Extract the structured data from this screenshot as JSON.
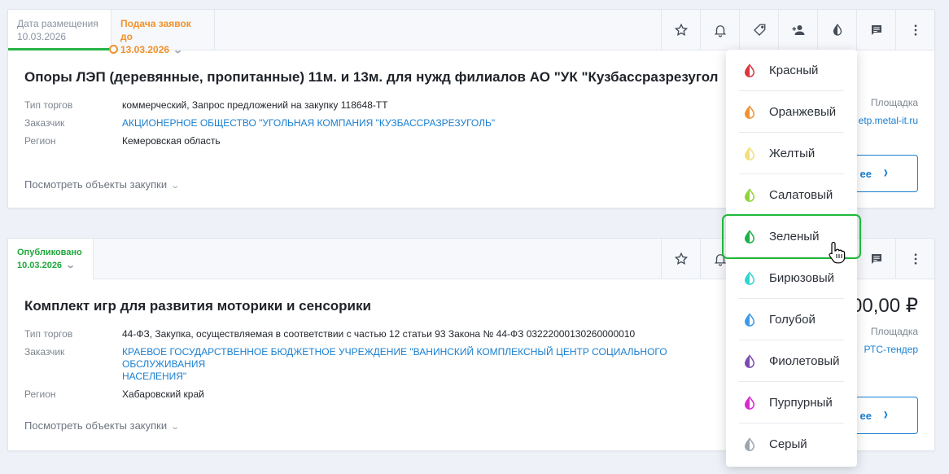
{
  "card1": {
    "posted_label": "Дата размещения",
    "posted_date": "10.03.2026",
    "deadline_label": "Подача заявок до",
    "deadline_date": "13.03.2026",
    "title": "Опоры ЛЭП (деревянные, пропитанные) 11м. и 13м. для нужд филиалов АО \"УК \"Кузбассразрезугол",
    "props": [
      {
        "key": "Тип торгов",
        "value": "коммерческий, Запрос предложений на закупку 118648-ТТ"
      },
      {
        "key": "Заказчик",
        "value": "АКЦИОНЕРНОЕ ОБЩЕСТВО \"УГОЛЬНАЯ КОМПАНИЯ \"КУЗБАССРАЗРЕЗУГОЛЬ\""
      },
      {
        "key": "Регион",
        "value": "Кемеровская область"
      }
    ],
    "platform_label": "Площадка",
    "platform_value": "etp.metal-it.ru",
    "more_label": "Посмотреть объекты закупки",
    "details_button": "ее"
  },
  "card2": {
    "status_label": "Опубликовано",
    "status_date": "10.03.2026",
    "title": "Комплект игр для развития моторики и сенсорики",
    "props": [
      {
        "key": "Тип торгов",
        "value": "44-ФЗ, Закупка, осуществляемая в соответствии с частью 12 статьи 93 Закона № 44-ФЗ 03222000130260000010"
      },
      {
        "key": "Заказчик",
        "value": "КРАЕВОЕ ГОСУДАРСТВЕННОЕ БЮДЖЕТНОЕ УЧРЕЖДЕНИЕ \"ВАНИНСКИЙ КОМПЛЕКСНЫЙ ЦЕНТР СОЦИАЛЬНОГО ОБСЛУЖИВАНИЯ",
        "value2": "НАСЕЛЕНИЯ\""
      },
      {
        "key": "Регион",
        "value": "Хабаровский край"
      }
    ],
    "price": "00,00 ₽",
    "platform_label": "Площадка",
    "platform_value": "РТС-тендер",
    "more_label": "Посмотреть объекты закупки",
    "details_button": "ее"
  },
  "actions": [
    "star-icon",
    "bell-icon",
    "tag-icon",
    "add-user-icon",
    "contrast-icon",
    "comment-icon",
    "more-vertical-icon"
  ],
  "color_menu": {
    "items": [
      {
        "label": "Красный",
        "color": "#d9363e"
      },
      {
        "label": "Оранжевый",
        "color": "#f0922b"
      },
      {
        "label": "Желтый",
        "color": "#f2df7a"
      },
      {
        "label": "Салатовый",
        "color": "#8fd43a"
      },
      {
        "label": "Зеленый",
        "color": "#1fb04a"
      },
      {
        "label": "Бирюзовый",
        "color": "#2fd6d0"
      },
      {
        "label": "Голубой",
        "color": "#3d9ae8"
      },
      {
        "label": "Фиолетовый",
        "color": "#7a4ab0"
      },
      {
        "label": "Пурпурный",
        "color": "#d62ad0"
      },
      {
        "label": "Серый",
        "color": "#9aa5b0"
      }
    ],
    "selected": "Зеленый"
  }
}
